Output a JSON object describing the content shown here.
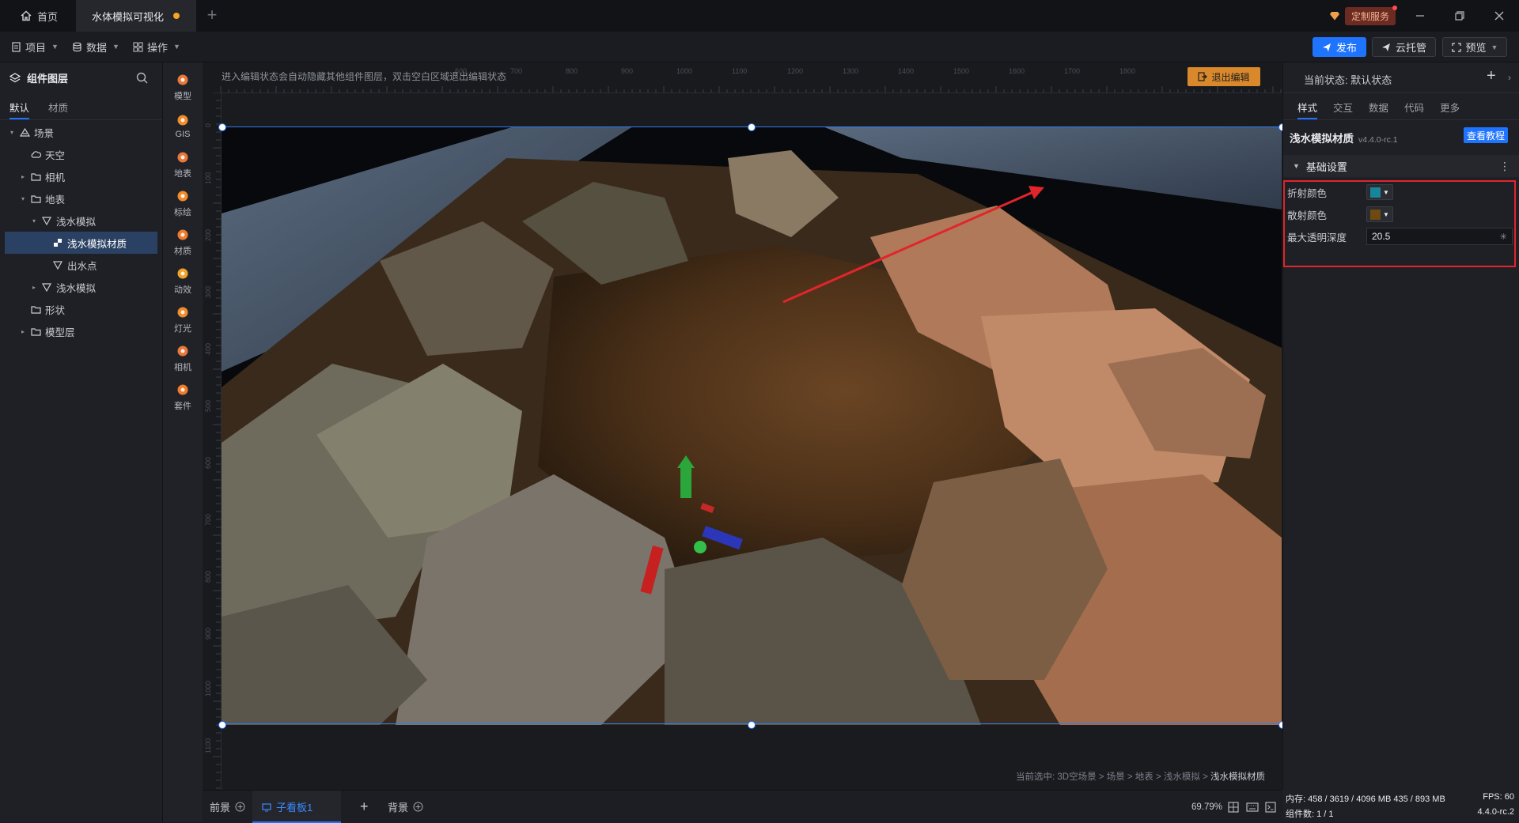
{
  "tabs": {
    "home_label": "首页",
    "doc_title": "水体模拟可视化"
  },
  "titlebar": {
    "custom_service": "定制服务"
  },
  "menu": {
    "project": "项目",
    "data": "数据",
    "operation": "操作",
    "publish": "发布",
    "cloud_host": "云托管",
    "preview": "预览"
  },
  "layer_panel": {
    "title": "组件图层",
    "tab_default": "默认",
    "tab_material": "材质",
    "tree": [
      {
        "label": "场景",
        "depth": 0,
        "arrow": "▾",
        "icon": "scene-icon"
      },
      {
        "label": "天空",
        "depth": 1,
        "arrow": "",
        "icon": "sky-icon"
      },
      {
        "label": "相机",
        "depth": 1,
        "arrow": "▸",
        "icon": "folder-icon"
      },
      {
        "label": "地表",
        "depth": 1,
        "arrow": "▾",
        "icon": "folder-icon"
      },
      {
        "label": "浅水模拟",
        "depth": 2,
        "arrow": "▾",
        "icon": "water-icon"
      },
      {
        "label": "浅水模拟材质",
        "depth": 3,
        "arrow": "",
        "icon": "material-icon",
        "selected": true
      },
      {
        "label": "出水点",
        "depth": 3,
        "arrow": "",
        "icon": "water-icon"
      },
      {
        "label": "浅水模拟",
        "depth": 2,
        "arrow": "▸",
        "icon": "water-icon"
      },
      {
        "label": "形状",
        "depth": 1,
        "arrow": "",
        "icon": "folder-icon"
      },
      {
        "label": "模型层",
        "depth": 1,
        "arrow": "▸",
        "icon": "folder-icon"
      }
    ]
  },
  "tools": [
    {
      "label": "模型",
      "icon": "model-icon",
      "color": "#e8773a"
    },
    {
      "label": "GIS",
      "icon": "gis-icon",
      "color": "#f08c2b"
    },
    {
      "label": "地表",
      "icon": "terrain-icon",
      "color": "#e8773a"
    },
    {
      "label": "标绘",
      "icon": "marker-icon",
      "color": "#f08c2b"
    },
    {
      "label": "材质",
      "icon": "material-ball-icon",
      "color": "#ef7b2c"
    },
    {
      "label": "动效",
      "icon": "effect-icon",
      "color": "#f0a22b"
    },
    {
      "label": "灯光",
      "icon": "light-icon",
      "color": "#f08c2b"
    },
    {
      "label": "相机",
      "icon": "camera-icon",
      "color": "#e8773a"
    },
    {
      "label": "套件",
      "icon": "kit-icon",
      "color": "#ef7b2c"
    }
  ],
  "canvas": {
    "hint": "进入编辑状态会自动隐藏其他组件图层，双击空白区域退出编辑状态",
    "exit_edit": "退出编辑",
    "ruler_top_ticks": [
      "600",
      "700",
      "800",
      "900",
      "1000",
      "1100",
      "1200",
      "1300",
      "1400",
      "1500",
      "1600",
      "1700",
      "1800"
    ],
    "ruler_left_ticks": [
      "0",
      "100",
      "200",
      "300",
      "400",
      "500",
      "600",
      "700",
      "800",
      "900",
      "1000",
      "1100"
    ],
    "breadcrumb_prefix": "当前选中: 3D空场景 > 场景 > 地表 > 浅水模拟 > ",
    "breadcrumb_last": "浅水模拟材质"
  },
  "bottom": {
    "foreground": "前景",
    "subboard": "子看板1",
    "background": "背景",
    "zoom": "69.79%"
  },
  "right_panel": {
    "state_label": "当前状态: 默认状态",
    "tabs": [
      "样式",
      "交互",
      "数据",
      "代码",
      "更多"
    ],
    "component_name": "浅水模拟材质",
    "component_version": "v4.4.0-rc.1",
    "tutorial": "查看教程",
    "section": "基础设置",
    "fields": {
      "refraction_label": "折射颜色",
      "refraction_color": "#16879a",
      "scatter_label": "散射颜色",
      "scatter_color": "#6e4a10",
      "depth_label": "最大透明深度",
      "depth_value": "20.5"
    }
  },
  "stats": {
    "memory": "内存: 458 / 3619 / 4096 MB  435 / 893 MB",
    "fps": "FPS: 60",
    "components": "组件数: 1 / 1",
    "version": "4.4.0-rc.2"
  },
  "colors": {
    "accent": "#1f74ff",
    "exit_button": "#d9892c",
    "highlight_box": "#e0252b"
  }
}
